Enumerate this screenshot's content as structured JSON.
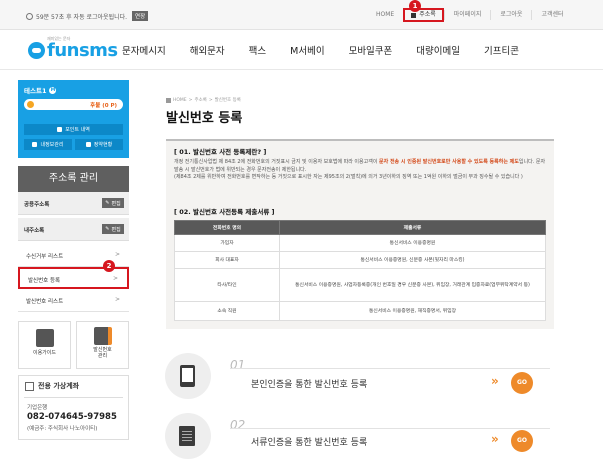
{
  "topbar": {
    "session_text": "59분 57초 후 자동 로그아웃됩니다.",
    "extend_label": "연장",
    "links": [
      "HOME",
      "주소록",
      "마이페이지",
      "로그아웃",
      "고객센터"
    ],
    "highlight_badge": "1"
  },
  "header": {
    "logo_text": "funsms",
    "logo_sub": "재미있는 문자",
    "nav": [
      "문자메시지",
      "해외문자",
      "팩스",
      "M서베이",
      "모바일쿠폰",
      "대량이메일",
      "기프티콘"
    ]
  },
  "sidebar": {
    "user_name": "테스트1",
    "user_badge": "M",
    "point_label": "후불 (0 P)",
    "buttons": [
      "포인트 내역",
      "내정보관리",
      "정약현황"
    ],
    "title": "주소록 관리",
    "sections": [
      {
        "label": "공용주소록",
        "edit": "편집"
      },
      {
        "label": "내주소록",
        "edit": "편집"
      }
    ],
    "links": [
      {
        "label": "수신거부 리스트",
        "arrow": ">"
      },
      {
        "label": "발신번호 등록",
        "arrow": ">"
      },
      {
        "label": "발신번호 리스트",
        "arrow": ">"
      }
    ],
    "highlight_badge": "2",
    "quick": [
      {
        "label": "이용가이드"
      },
      {
        "label": "발신번호",
        "label2": "관리"
      }
    ],
    "account": {
      "title": "전용 가상계좌",
      "bank": "기업은행",
      "number": "082-074645-97985",
      "holder": "(예금주: 주식회사 나노아이티)"
    }
  },
  "main": {
    "breadcrumb": [
      "HOME",
      ">",
      "주소록",
      ">",
      "발신번호 등록"
    ],
    "title": "발신번호 등록",
    "section1_title": "[ 01. 발신번호 사전 등록제란? ]",
    "section1_text_a": "개정 전기통신사업법 제 84조 2에 전화번호의 거짓표시 금지 및 이용자 보호법에 따라 이용고객이 ",
    "section1_text_red": "문자 전송 시 인증된 발신번호로만 사용할 수 있도록 등록하는 제도",
    "section1_text_b": "입니다. 문자 발송 시 발신번호가 법에 위반되는 경우 문자전송이 제한됩니다.",
    "section1_text_c": "(제84조 2제를 위반하여 전화번호를 변작하는 등 거짓으로 표시한 자는 제95조의 2(벌칙)에 의거 3년이하의 징역 또는 1억원 이하의 벌금이 부과 징수될 수 있습니다 )",
    "section2_title": "[ 02. 발신번호 사전등록 제출서류 ]",
    "table": {
      "headers": [
        "전화번호 명의",
        "제출서류"
      ],
      "rows": [
        [
          "가입자",
          "통신서비스 이용증명원"
        ],
        [
          "회사 대표자",
          "통신서비스 이용증명원, 신분증 사본(뒷자리 마스킹)"
        ],
        [
          "타사/타인",
          "통신서비스 이용증명원, 사업자등록증(개인 번호일 경우 신분증 사본), 위임장, 거래관계 입증자료(업무위탁계약서 등)"
        ],
        [
          "소속 직원",
          "통신서비스 이용증명원, 재직증명서, 위임장"
        ]
      ]
    },
    "methods": [
      {
        "num": "01",
        "label": "본인인증을 통한 발신번호 등록",
        "arrow": "»",
        "go": "GO",
        "icon": "phone-icon"
      },
      {
        "num": "02",
        "label": "서류인증을 통한 발신번호 등록",
        "arrow": "»",
        "go": "GO",
        "icon": "document-icon"
      }
    ]
  },
  "colors": {
    "brand": "#18a0e4",
    "highlight": "#d6171f",
    "go": "#ee8a2a",
    "sidebar_title": "#5f5f5f"
  }
}
